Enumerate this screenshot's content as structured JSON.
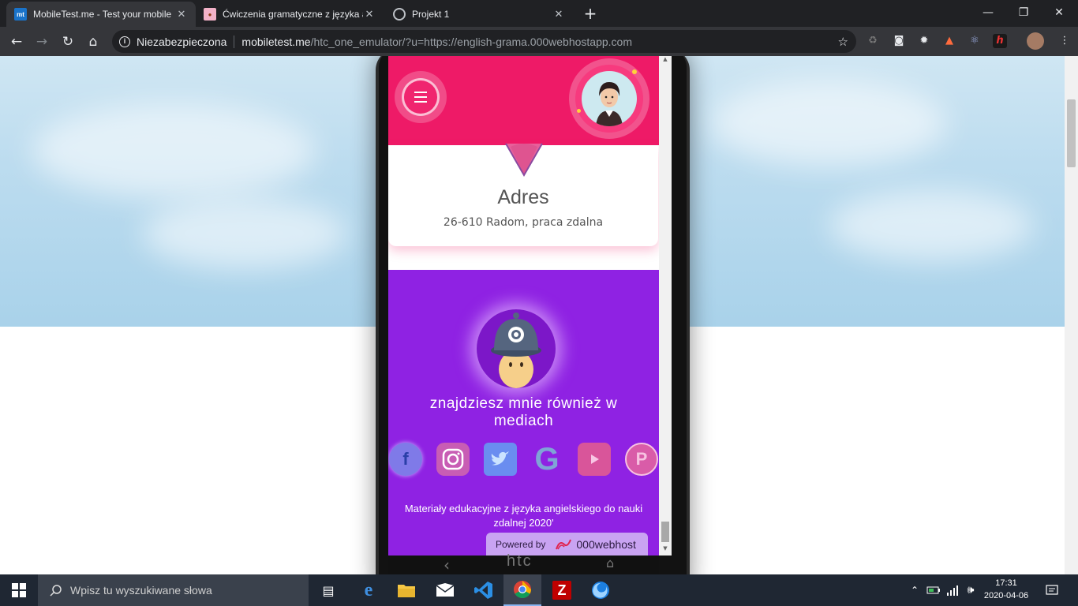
{
  "browser": {
    "tabs": [
      {
        "title": "MobileTest.me - Test your mobile",
        "favicon": "mt"
      },
      {
        "title": "Ćwiczenia gramatyczne z języka a",
        "favicon": "cupcake-icon"
      },
      {
        "title": "Projekt 1",
        "favicon": "globe-icon"
      }
    ],
    "address": {
      "security_label": "Niezabezpieczona",
      "host": "mobiletest.me",
      "path": "/htc_one_emulator/?u=https://english-grama.000webhostapp.com"
    }
  },
  "site": {
    "address_card": {
      "heading": "Adres",
      "value": "26-610 Radom, praca zdalna"
    },
    "media": {
      "title": "znajdziesz mnie również w mediach",
      "socials": [
        "facebook-icon",
        "instagram-icon",
        "twitter-icon",
        "google-icon",
        "youtube-icon",
        "pinterest-icon"
      ]
    },
    "footer": "Materiały edukacyjne z języka angielskiego do nauki zdalnej 2020'",
    "powered": {
      "label": "Powered by",
      "brand": "000webhost"
    }
  },
  "phone": {
    "brand": "htc"
  },
  "taskbar": {
    "search_placeholder": "Wpisz tu wyszukiwane słowa",
    "time": "17:31",
    "date": "2020-04-06"
  },
  "colors": {
    "site_pink": "#ee1a67",
    "site_purple": "#8f22e3",
    "chrome_dark": "#202124"
  }
}
